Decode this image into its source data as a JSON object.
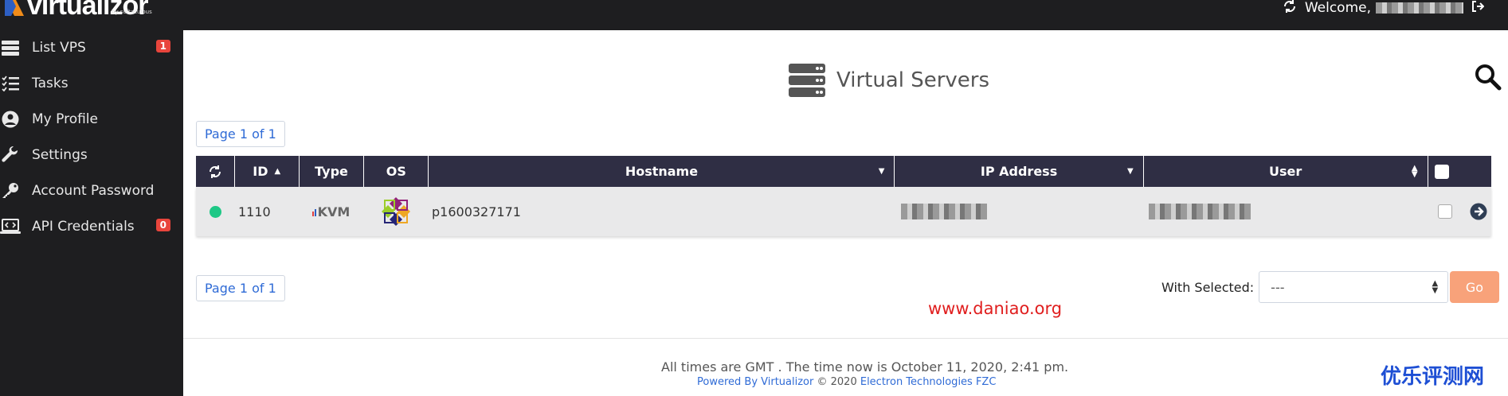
{
  "app": {
    "logo_text": "virtualizor",
    "logo_sub": "by softaculous"
  },
  "topbar": {
    "welcome_label": "Welcome,",
    "icons": [
      "refresh-icon",
      "logout-icon"
    ]
  },
  "sidebar": {
    "items": [
      {
        "label": "List VPS",
        "icon": "server-list-icon",
        "badge": "1"
      },
      {
        "label": "Tasks",
        "icon": "tasks-icon",
        "badge": ""
      },
      {
        "label": "My Profile",
        "icon": "user-circle-icon",
        "badge": ""
      },
      {
        "label": "Settings",
        "icon": "wrench-icon",
        "badge": ""
      },
      {
        "label": "Account Password",
        "icon": "key-icon",
        "badge": ""
      },
      {
        "label": "API Credentials",
        "icon": "laptop-code-icon",
        "badge": "0"
      }
    ]
  },
  "header": {
    "title": "Virtual Servers"
  },
  "pager": {
    "label": "Page 1 of 1"
  },
  "table": {
    "columns": [
      "ID",
      "Type",
      "OS",
      "Hostname",
      "IP Address",
      "User"
    ],
    "rows": [
      {
        "status": "online",
        "id": "1110",
        "type": "KVM",
        "os": "centos",
        "hostname": "p1600327171"
      }
    ]
  },
  "actions": {
    "with_selected_label": "With Selected:",
    "select_value": "---",
    "go_label": "Go"
  },
  "watermark": "www.daniao.org",
  "footer": {
    "time_text": "All times are GMT . The time now is October 11, 2020, 2:41 pm.",
    "powered_prefix": "Powered By Virtualizor",
    "copyright": "© 2020",
    "company": "Electron Technologies FZC"
  },
  "cn_watermark": "优乐评测网",
  "colors": {
    "sidebar_bg": "#1e1e20",
    "table_header_bg": "#2f2e44",
    "status_online": "#1ec886",
    "badge_red": "#e8453c",
    "go_button": "#f8a27a",
    "link_blue": "#2f6bd6"
  }
}
